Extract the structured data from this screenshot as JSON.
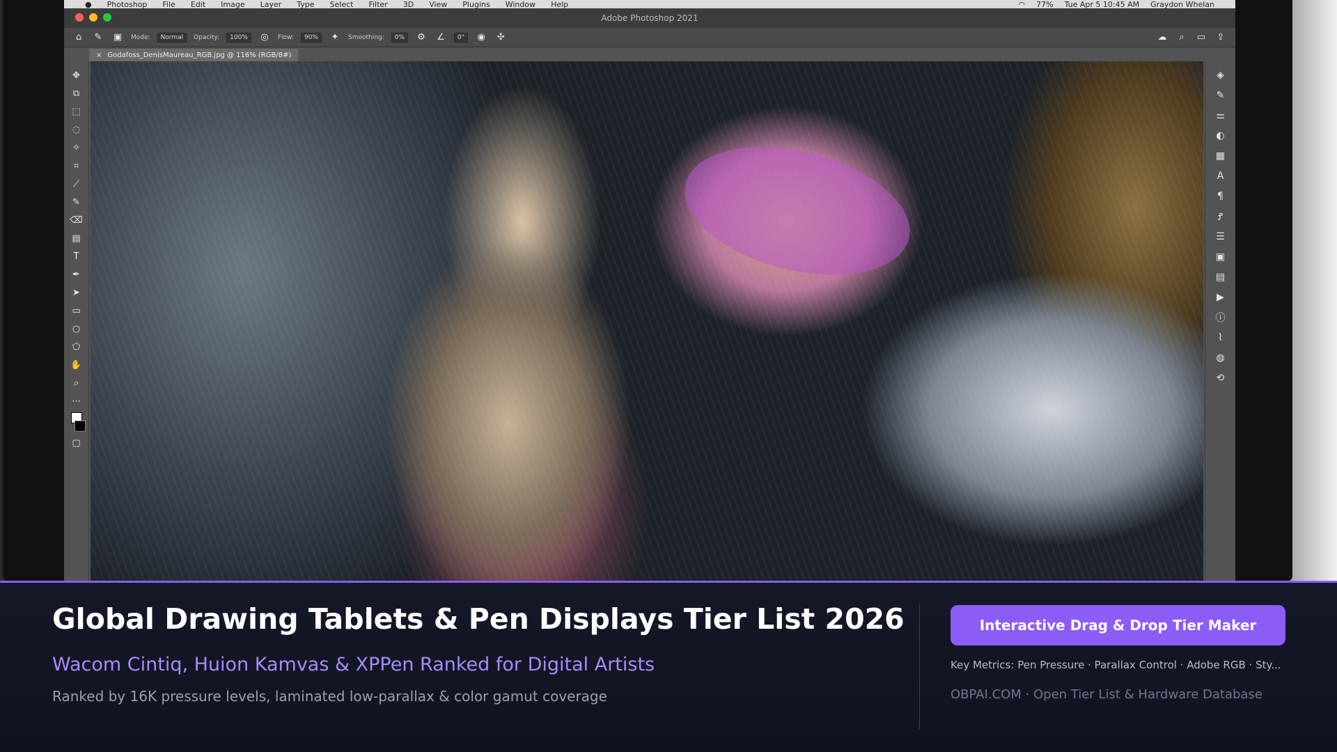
{
  "menubar": {
    "items": [
      "Photoshop",
      "File",
      "Edit",
      "Image",
      "Layer",
      "Type",
      "Select",
      "Filter",
      "3D",
      "View",
      "Plugins",
      "Window",
      "Help"
    ],
    "clock": "Tue Apr 5  10:45 AM",
    "user": "Graydon Whelan",
    "battery": "77%"
  },
  "app": {
    "title": "Adobe Photoshop 2021",
    "options": {
      "mode_label": "Mode:",
      "mode_value": "Normal",
      "opacity_label": "Opacity:",
      "opacity_value": "100%",
      "flow_label": "Flow:",
      "flow_value": "90%",
      "smoothing_label": "Smoothing:",
      "smoothing_value": "0%",
      "angle_value": "0°"
    },
    "document_tab": "Godafoss_DenisMaureau_RGB.jpg @ 116% (RGB/8#)"
  },
  "info": {
    "title": "Global Drawing Tablets & Pen Displays Tier List 2026",
    "subtitle": "Wacom Cintiq, Huion Kamvas & XPPen Ranked for Digital Artists",
    "tagline": "Ranked by 16K pressure levels, laminated low-parallax & color gamut coverage",
    "cta_label": "Interactive Drag & Drop Tier Maker",
    "metrics": "Key Metrics: Pen Pressure · Parallax Control · Adobe RGB · Sty...",
    "site": "OBPAI.COM · Open Tier List & Hardware Database"
  },
  "colors": {
    "accent": "#8b5cf6",
    "subtitle": "#a78bfa",
    "background": "#10131f"
  }
}
